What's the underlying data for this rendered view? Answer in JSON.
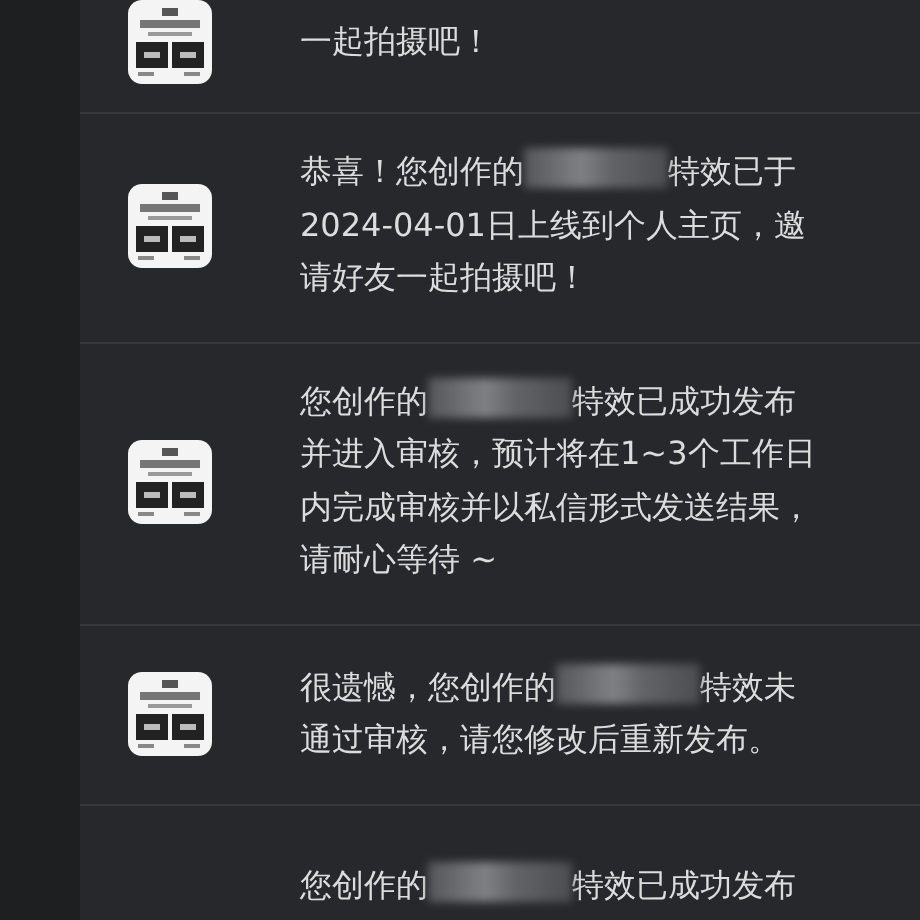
{
  "messages": [
    {
      "before": "一起拍摄吧！",
      "redacted": false
    },
    {
      "before": "恭喜！您创作的",
      "redacted": true,
      "after": "特效已于2024-04-01日上线到个人主页，邀请好友一起拍摄吧！"
    },
    {
      "before": "您创作的",
      "redacted": true,
      "after": "特效已成功发布并进入审核，预计将在1~3个工作日内完成审核并以私信形式发送结果，请耐心等待 ~"
    },
    {
      "before": "很遗憾，您创作的",
      "redacted": true,
      "after": "特效未通过审核，请您修改后重新发布。"
    },
    {
      "before": "您创作的",
      "redacted": true,
      "after": "特效已成功发布",
      "thumbnail": {
        "kind": "none"
      }
    }
  ]
}
